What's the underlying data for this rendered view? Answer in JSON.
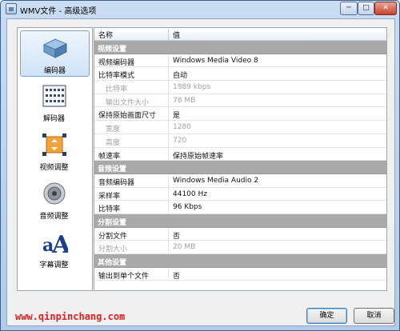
{
  "window": {
    "title": "WMV文件 - 高级选项",
    "controls": {
      "minimize": "─",
      "maximize": "□",
      "close": "✕"
    }
  },
  "sidebar": {
    "items": [
      {
        "label": "编码器",
        "icon": "encoder-icon",
        "selected": true
      },
      {
        "label": "解码器",
        "icon": "decoder-icon",
        "selected": false
      },
      {
        "label": "视频调整",
        "icon": "video-adjust-icon",
        "selected": false
      },
      {
        "label": "音频调整",
        "icon": "speaker-icon",
        "selected": false
      },
      {
        "label": "字幕调整",
        "icon": "subtitle-icon",
        "selected": false
      }
    ]
  },
  "table": {
    "headers": {
      "name": "名称",
      "value": "值"
    },
    "rows": [
      {
        "type": "section",
        "name": "视频设置",
        "value": ""
      },
      {
        "type": "item",
        "name": "视频编码器",
        "value": "Windows Media Video 8"
      },
      {
        "type": "item",
        "name": "比特率模式",
        "value": "自动"
      },
      {
        "type": "disabled",
        "name": "比特率",
        "value": "1989 kbps"
      },
      {
        "type": "disabled",
        "name": "输出文件大小",
        "value": "78 MB"
      },
      {
        "type": "item",
        "name": "保持原始画面尺寸",
        "value": "是"
      },
      {
        "type": "disabled",
        "name": "宽度",
        "value": "1280"
      },
      {
        "type": "disabled",
        "name": "高度",
        "value": "720"
      },
      {
        "type": "item",
        "name": "帧速率",
        "value": "保持原始帧速率"
      },
      {
        "type": "section",
        "name": "音频设置",
        "value": ""
      },
      {
        "type": "item",
        "name": "音频编码器",
        "value": "Windows Media Audio 2"
      },
      {
        "type": "item",
        "name": "采样率",
        "value": "44100 Hz"
      },
      {
        "type": "item",
        "name": "比特率",
        "value": "96 Kbps"
      },
      {
        "type": "section",
        "name": "分割设置",
        "value": ""
      },
      {
        "type": "item",
        "name": "分割文件",
        "value": "否"
      },
      {
        "type": "disabled-flush",
        "name": "分割大小",
        "value": "20 MB"
      },
      {
        "type": "section",
        "name": "其他设置",
        "value": ""
      },
      {
        "type": "item",
        "name": "输出到单个文件",
        "value": "否"
      }
    ]
  },
  "footer": {
    "watermark": "www.qinpinchang.com",
    "ok_label": "确定",
    "cancel_label": "取消"
  }
}
